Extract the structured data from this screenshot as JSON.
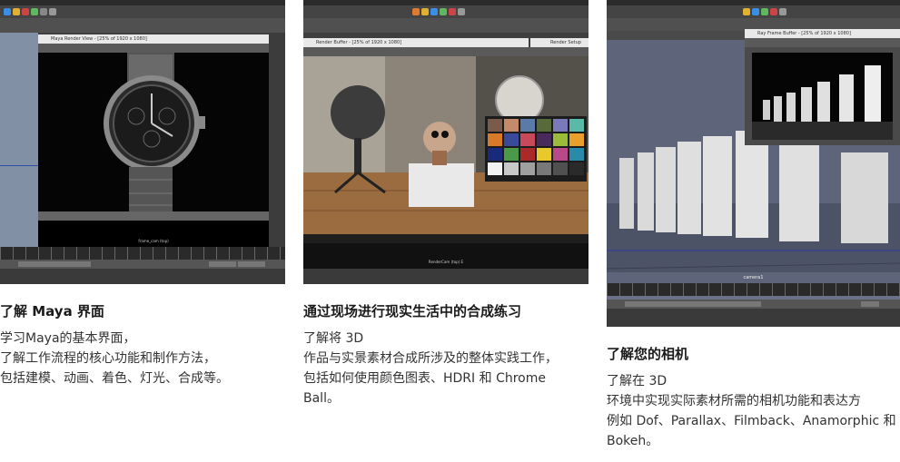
{
  "cards": [
    {
      "title": "了解 Maya 界面",
      "lines": [
        "学习Maya的基本界面，",
        "了解工作流程的核心功能和制作方法，",
        "包括建模、动画、着色、灯光、合成等。"
      ],
      "render_window_title": "Maya Render View - [25% of 1920 x 1080]",
      "frame_label": "frame_cam (top)"
    },
    {
      "title": "通过现场进行现实生活中的合成练习",
      "lines": [
        "了解将 3D",
        "作品与实景素材合成所涉及的整体实践工作，",
        "包括如何使用颜色图表、HDRI 和 Chrome",
        "Ball。"
      ],
      "render_window_title": "Render Buffer - [25% of 1920 x 1080]",
      "panel_title": "Render Setup",
      "frame_label": "RenderCam (top) E"
    },
    {
      "title": "了解您的相机",
      "lines": [
        "了解在 3D",
        "环境中实现实际素材所需的相机功能和表达方",
        "例如 Dof、Parallax、Filmback、Anamorphic 和",
        "Bokeh。"
      ],
      "render_window_title": "Ray Frame Buffer - [25% of 1920 x 1080]",
      "frame_label": "camera1"
    }
  ],
  "colors": {
    "maya_bg": "#3f3f3f",
    "title_text": "#1a1a1a",
    "body_text": "#333333"
  },
  "chart_data": null
}
